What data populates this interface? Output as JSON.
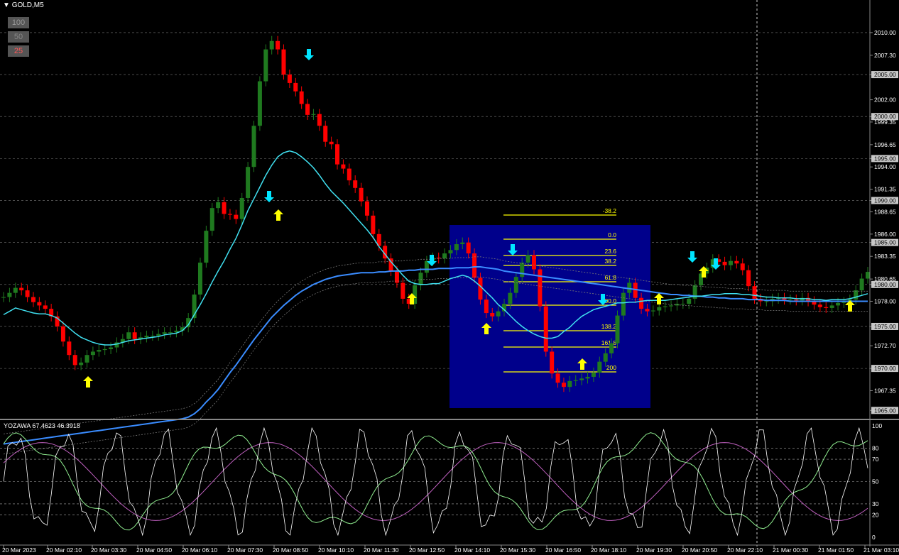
{
  "symbol": "GOLD,M5",
  "scale_buttons": [
    {
      "label": "100",
      "color": "#aaaaaa"
    },
    {
      "label": "50",
      "color": "#888888"
    },
    {
      "label": "25",
      "color": "#ff5a5a"
    }
  ],
  "oscillator": {
    "label": "YOZAWA 67.4623 46.3918"
  },
  "colors": {
    "background": "#000000",
    "grid": "#c8c8c8",
    "bull": "#1f7a1f",
    "bear": "#ff0000",
    "ma_fast": "#40e0f0",
    "ma_slow": "#3a8cff",
    "fib": "#ffff00",
    "fib_box": "#00008b",
    "buy_arrow": "#ffff00",
    "sell_arrow": "#00e5ff",
    "osc_main": "#ffffff",
    "osc_signal": "#c060c0",
    "osc_green": "#90ee90"
  },
  "price_axis": {
    "labels": [
      "2010.00",
      "2007.30",
      "2005.00",
      "2002.00",
      "2000.00",
      "1999.35",
      "1996.65",
      "1995.00",
      "1994.00",
      "1991.35",
      "1990.00",
      "1988.65",
      "1986.00",
      "1985.00",
      "1983.35",
      "1980.65",
      "1980.00",
      "1978.00",
      "1975.00",
      "1972.70",
      "1970.00",
      "1967.35",
      "1965.00"
    ],
    "highlighted": [
      "2005.00",
      "2000.00",
      "1995.00",
      "1990.00",
      "1985.00",
      "1980.00",
      "1975.00",
      "1970.00",
      "1965.00"
    ]
  },
  "osc_axis": {
    "labels": [
      "100",
      "80",
      "70",
      "50",
      "30",
      "20",
      "0"
    ]
  },
  "time_axis": {
    "labels": [
      "20 Mar 2023",
      "20 Mar 02:10",
      "20 Mar 03:30",
      "20 Mar 04:50",
      "20 Mar 06:10",
      "20 Mar 07:30",
      "20 Mar 08:50",
      "20 Mar 10:10",
      "20 Mar 11:30",
      "20 Mar 12:50",
      "20 Mar 14:10",
      "20 Mar 15:30",
      "20 Mar 16:50",
      "20 Mar 18:10",
      "20 Mar 19:30",
      "20 Mar 20:50",
      "20 Mar 22:10",
      "21 Mar 00:30",
      "21 Mar 01:50",
      "21 Mar 03:10"
    ]
  },
  "fib_levels": [
    "-38.2",
    "0.0",
    "23.6",
    "38.2",
    "61.8",
    "100.0",
    "138.2",
    "161.8",
    "200"
  ],
  "chart_data": {
    "type": "line",
    "series": [
      {
        "values": [
          1978.5,
          1979.0,
          1979.6,
          1979.3,
          1978.5,
          1977.9,
          1977.5,
          1977.1,
          1976.2,
          1975.0,
          1973.2,
          1971.6,
          1970.4,
          1970.7,
          1971.6,
          1972.0,
          1972.2,
          1972.3,
          1972.5,
          1973.1,
          1973.5,
          1974.3,
          1973.5,
          1973.7,
          1973.9,
          1973.9,
          1974.1,
          1974.3,
          1974.3,
          1974.5,
          1974.9,
          1976.0,
          1978.8,
          1982.6,
          1986.4,
          1989.1,
          1989.8,
          1988.4,
          1988.3,
          1987.8,
          1990.3,
          1994.0,
          1998.9,
          2004.2,
          2008.0,
          2009.0,
          2008.0,
          2005.0,
          2004.0,
          2003.0,
          2001.5,
          2000.2,
          2000.3,
          1998.9,
          1997.0,
          1996.7,
          1994.3,
          1993.8,
          1992.4,
          1991.5,
          1989.9,
          1988.2,
          1986.0,
          1984.6,
          1983.1,
          1981.6,
          1980.2,
          1978.3,
          1977.7,
          1979.9,
          1981.4,
          1982.8,
          1983.2,
          1983.1,
          1983.7,
          1984.1,
          1984.8,
          1985.0,
          1983.7,
          1980.8,
          1978.2,
          1976.6,
          1976.2,
          1976.8,
          1977.7,
          1979.0,
          1980.9,
          1982.6,
          1983.5,
          1981.8,
          1977.4,
          1972.0,
          1969.4,
          1968.3,
          1967.8,
          1968.5,
          1968.6,
          1968.8,
          1969.0,
          1969.5,
          1970.8,
          1971.8,
          1973.0,
          1976.3,
          1979.0,
          1980.2,
          1978.4,
          1977.1,
          1976.8,
          1976.9,
          1977.3,
          1977.4,
          1977.5,
          1977.7,
          1977.7,
          1978.3,
          1979.9,
          1981.3,
          1982.0,
          1983.0,
          1982.7,
          1982.3,
          1982.8,
          1982.5,
          1981.7,
          1979.8,
          1978.3,
          1978.0,
          1978.0,
          1978.3,
          1978.4,
          1978.2,
          1978.2,
          1978.1,
          1978.4,
          1978.0,
          1977.6,
          1977.3,
          1977.2,
          1977.5,
          1977.8,
          1977.9,
          1978.2,
          1979.3,
          1980.7,
          1981.5
        ]
      },
      {
        "values": [
          1976.4,
          1976.8,
          1977.2,
          1977.0,
          1976.8,
          1976.6,
          1976.5,
          1976.5,
          1976.3,
          1976.0,
          1975.4,
          1974.8,
          1974.2,
          1973.7,
          1973.4,
          1973.1,
          1972.9,
          1972.8,
          1972.8,
          1972.9,
          1973.1,
          1973.3,
          1973.4,
          1973.5,
          1973.6,
          1973.7,
          1973.8,
          1974.0,
          1974.1,
          1974.2,
          1974.5,
          1975.2,
          1976.4,
          1977.6,
          1978.9,
          1980.3,
          1981.6,
          1982.8,
          1984.2,
          1985.5,
          1987.1,
          1988.8,
          1990.2,
          1991.6,
          1993.0,
          1994.2,
          1995.2,
          1995.7,
          1995.9,
          1995.7,
          1995.2,
          1994.6,
          1993.9,
          1993.0,
          1992.0,
          1991.1,
          1990.4,
          1989.7,
          1988.9,
          1988.1,
          1987.3,
          1986.5,
          1985.6,
          1984.5,
          1983.6,
          1982.7,
          1981.9,
          1981.1,
          1980.4,
          1980.1,
          1980.0,
          1980.0,
          1980.1,
          1980.1,
          1980.4,
          1980.7,
          1980.9,
          1981.1,
          1980.9,
          1980.4,
          1979.8,
          1979.1,
          1978.4,
          1977.6,
          1977.0,
          1976.3,
          1975.6,
          1975.0,
          1974.5,
          1974.1,
          1973.8,
          1973.6,
          1973.6,
          1973.8,
          1974.4,
          1974.9,
          1975.6,
          1976.2,
          1976.6,
          1977.0,
          1977.2,
          1977.4,
          1977.6,
          1977.8,
          1977.8,
          1977.9,
          1977.9,
          1978.0,
          1978.1,
          1978.1,
          1978.1,
          1978.1,
          1978.2,
          1978.3,
          1978.4,
          1978.5,
          1978.6,
          1978.6,
          1978.7,
          1978.8,
          1978.8,
          1978.9,
          1978.9,
          1978.9,
          1978.8,
          1978.8,
          1978.7,
          1978.6,
          1978.5,
          1978.5,
          1978.4,
          1978.4,
          1978.4,
          1978.3,
          1978.3,
          1978.3,
          1978.2,
          1978.2,
          1978.1,
          1978.2,
          1978.2,
          1978.2,
          1978.3,
          1978.5,
          1978.7,
          1978.9
        ]
      },
      {
        "values": [
          1961.0,
          1961.1,
          1961.2,
          1961.3,
          1961.4,
          1961.5,
          1961.6,
          1961.7,
          1961.8,
          1961.9,
          1962.0,
          1962.1,
          1962.2,
          1962.3,
          1962.4,
          1962.5,
          1962.6,
          1962.7,
          1962.8,
          1962.9,
          1963.0,
          1963.1,
          1963.2,
          1963.3,
          1963.4,
          1963.5,
          1963.6,
          1963.7,
          1963.8,
          1963.9,
          1964.0,
          1964.2,
          1964.6,
          1965.2,
          1966.0,
          1966.7,
          1967.5,
          1968.5,
          1969.5,
          1970.4,
          1971.4,
          1972.4,
          1973.4,
          1974.3,
          1975.2,
          1976.1,
          1976.8,
          1977.5,
          1978.1,
          1978.7,
          1979.2,
          1979.6,
          1980.0,
          1980.3,
          1980.6,
          1980.8,
          1981.0,
          1981.1,
          1981.2,
          1981.3,
          1981.4,
          1981.4,
          1981.4,
          1981.5,
          1981.5,
          1981.6,
          1981.6,
          1981.6,
          1981.7,
          1981.7,
          1981.8,
          1981.8,
          1981.8,
          1981.9,
          1981.9,
          1981.9,
          1982.0,
          1982.0,
          1982.0,
          1982.1,
          1982.1,
          1982.0,
          1981.9,
          1981.8,
          1981.6,
          1981.5,
          1981.4,
          1981.3,
          1981.2,
          1981.1,
          1981.0,
          1980.9,
          1980.8,
          1980.7,
          1980.6,
          1980.5,
          1980.4,
          1980.3,
          1980.2,
          1980.1,
          1980.0,
          1979.9,
          1979.8,
          1979.7,
          1979.6,
          1979.5,
          1979.4,
          1979.3,
          1979.2,
          1979.1,
          1979.0,
          1978.9,
          1978.8,
          1978.8,
          1978.7,
          1978.7,
          1978.6,
          1978.6,
          1978.5,
          1978.5,
          1978.4,
          1978.4,
          1978.3,
          1978.3,
          1978.3,
          1978.2,
          1978.2,
          1978.2,
          1978.1,
          1978.1,
          1978.1,
          1978.1,
          1978.0,
          1978.0,
          1978.0,
          1978.0,
          1978.0,
          1978.0,
          1978.0,
          1978.0,
          1978.0,
          1978.0,
          1978.0,
          1978.0,
          1978.0,
          1978.0
        ]
      }
    ],
    "ylim": [
      1964.6,
      2011.6
    ],
    "osc_ylim": [
      0,
      100
    ]
  }
}
